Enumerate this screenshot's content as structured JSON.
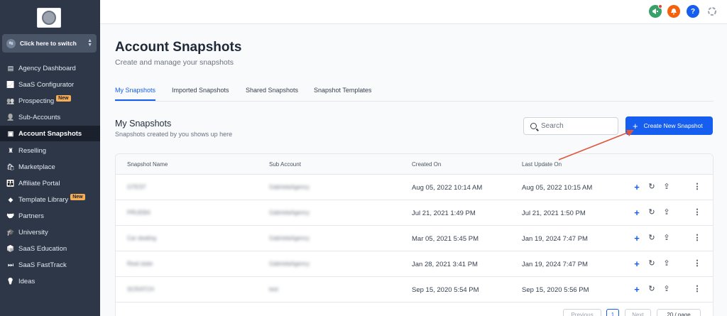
{
  "sidebar": {
    "switcher_label": "Click here to switch",
    "items": [
      {
        "label": "Agency Dashboard",
        "icon": "dashboard-icon"
      },
      {
        "label": "SaaS Configurator",
        "icon": "chart-icon"
      },
      {
        "label": "Prospecting",
        "icon": "users-icon",
        "badge": "New"
      },
      {
        "label": "Sub-Accounts",
        "icon": "user-icon"
      },
      {
        "label": "Account Snapshots",
        "icon": "snapshot-icon",
        "active": true
      },
      {
        "label": "Reselling",
        "icon": "reselling-icon"
      },
      {
        "label": "Marketplace",
        "icon": "bag-icon"
      },
      {
        "label": "Affiliate Portal",
        "icon": "group-icon"
      },
      {
        "label": "Template Library",
        "icon": "shapes-icon",
        "badge": "New"
      },
      {
        "label": "Partners",
        "icon": "handshake-icon"
      },
      {
        "label": "University",
        "icon": "graduation-icon"
      },
      {
        "label": "SaaS Education",
        "icon": "box-icon"
      },
      {
        "label": "SaaS FastTrack",
        "icon": "fast-forward-icon"
      },
      {
        "label": "Ideas",
        "icon": "bulb-icon"
      }
    ]
  },
  "topbar": {
    "icons": [
      {
        "name": "announcement-icon",
        "color": "#38a169",
        "glyph": "📢"
      },
      {
        "name": "notification-icon",
        "color": "#f6610b",
        "glyph": "🔔"
      },
      {
        "name": "help-icon",
        "color": "#155eef",
        "glyph": "?"
      }
    ]
  },
  "page": {
    "title": "Account Snapshots",
    "subtitle": "Create and manage your snapshots"
  },
  "tabs": [
    "My Snapshots",
    "Imported Snapshots",
    "Shared Snapshots",
    "Snapshot Templates"
  ],
  "section": {
    "title": "My Snapshots",
    "subtitle": "Snapshots created by you shows up here"
  },
  "search": {
    "placeholder": "Search"
  },
  "create_button": {
    "label": "Create New Snapshot"
  },
  "table": {
    "headers": [
      "Snapshot Name",
      "Sub Account",
      "Created On",
      "Last Update On"
    ],
    "rows": [
      {
        "name": "GTEST",
        "sub_account": "GabrielaAgency",
        "created": "Aug 05, 2022 10:14 AM",
        "updated": "Aug 05, 2022 10:15 AM"
      },
      {
        "name": "PRUEBA",
        "sub_account": "GabrielaAgency",
        "created": "Jul 21, 2021 1:49 PM",
        "updated": "Jul 21, 2021 1:50 PM"
      },
      {
        "name": "Car dealing",
        "sub_account": "GabrielaAgency",
        "created": "Mar 05, 2021 5:45 PM",
        "updated": "Jan 19, 2024 7:47 PM"
      },
      {
        "name": "Real state",
        "sub_account": "GabrielaAgency",
        "created": "Jan 28, 2021 3:41 PM",
        "updated": "Jan 19, 2024 7:47 PM"
      },
      {
        "name": "SCRATCH",
        "sub_account": "test",
        "created": "Sep 15, 2020 5:54 PM",
        "updated": "Sep 15, 2020 5:56 PM"
      }
    ]
  },
  "pagination": {
    "previous": "Previous",
    "current": "1",
    "next": "Next",
    "per_page": "20 / page"
  },
  "colors": {
    "primary": "#155eef",
    "sidebar_bg": "#2d3748",
    "annotation_arrow": "#e0563a"
  }
}
